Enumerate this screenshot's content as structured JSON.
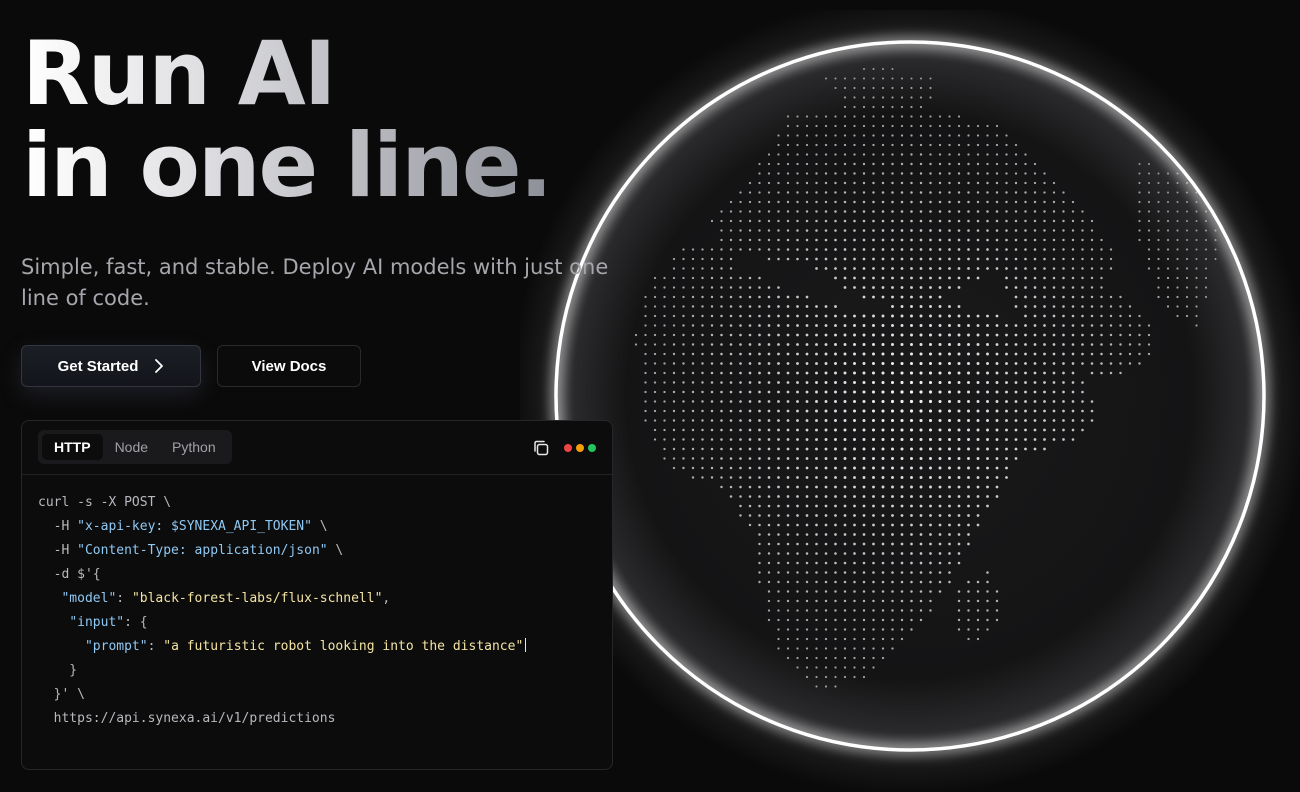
{
  "hero": {
    "title_line1": "Run AI",
    "title_line2": "in one line.",
    "subtitle": "Simple, fast, and stable. Deploy AI models with just one line of code."
  },
  "actions": {
    "get_started_label": "Get Started",
    "view_docs_label": "View Docs"
  },
  "code_panel": {
    "tabs": [
      {
        "label": "HTTP",
        "active": true
      },
      {
        "label": "Node",
        "active": false
      },
      {
        "label": "Python",
        "active": false
      }
    ],
    "copy_icon": "copy-icon",
    "window_dots": [
      "#ef4444",
      "#f59e0b",
      "#22c55e"
    ],
    "lines": [
      "curl -s -X POST \\",
      "  -H ",
      "\"x-api-key: $SYNEXA_API_TOKEN\"",
      " \\",
      "  -H ",
      "\"Content-Type: application/json\"",
      " \\",
      "  -d $'{",
      "   ",
      "\"model\"",
      ": ",
      "\"black-forest-labs/flux-schnell\"",
      ",",
      "    ",
      "\"input\"",
      ": {",
      "      ",
      "\"prompt\"",
      ": ",
      "\"a futuristic robot looking into the distance\"",
      "    }",
      "  }' \\",
      "  https://api.synexa.ai/v1/predictions"
    ]
  },
  "colors": {
    "background": "#0a0a0a",
    "key": "#8fc8f2",
    "string": "#f3e3a2",
    "globe_rim": "#ffffff"
  }
}
